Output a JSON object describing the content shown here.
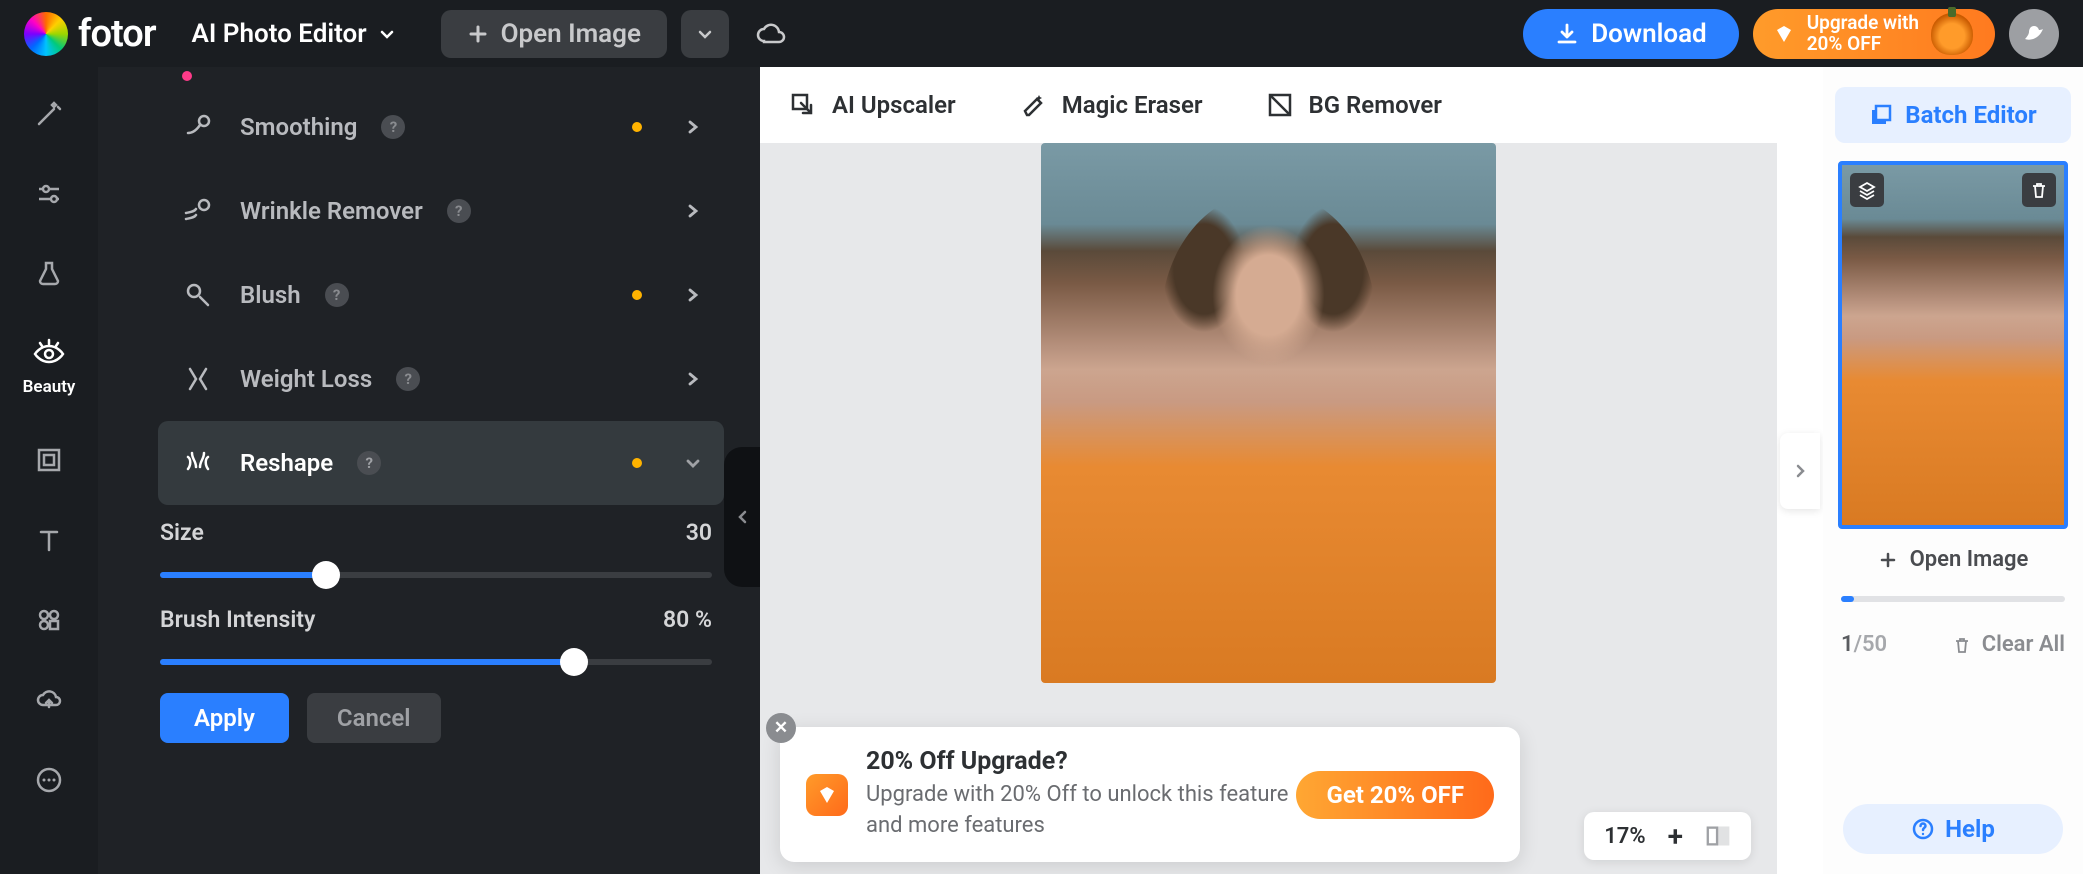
{
  "header": {
    "brand": "fotor",
    "mode": "AI Photo Editor",
    "open_image": "Open Image",
    "download": "Download",
    "upgrade_line1": "Upgrade with",
    "upgrade_line2": "20% OFF"
  },
  "rail": {
    "items": [
      "",
      "",
      "",
      "Beauty",
      "",
      "",
      "",
      "",
      ""
    ]
  },
  "panel": {
    "tools": [
      {
        "name": "Smoothing",
        "dot": true,
        "open": false
      },
      {
        "name": "Wrinkle Remover",
        "dot": false,
        "open": false
      },
      {
        "name": "Blush",
        "dot": true,
        "open": false
      },
      {
        "name": "Weight Loss",
        "dot": false,
        "open": false
      },
      {
        "name": "Reshape",
        "dot": true,
        "open": true
      }
    ],
    "sliders": {
      "size_label": "Size",
      "size_value": "30",
      "size_pct": 30,
      "brush_label": "Brush Intensity",
      "brush_value": "80 %",
      "brush_pct": 80
    },
    "apply": "Apply",
    "cancel": "Cancel"
  },
  "canvas_tools": {
    "upscaler": "AI Upscaler",
    "eraser": "Magic Eraser",
    "bg": "BG Remover"
  },
  "promo": {
    "title": "20% Off Upgrade?",
    "body": "Upgrade with 20% Off to unlock this feature and more features",
    "cta": "Get 20% OFF"
  },
  "zoom": {
    "value": "17%",
    "plus": "+"
  },
  "rpanel": {
    "batch": "Batch Editor",
    "open": "Open Image",
    "count_current": "1",
    "count_total": "/50",
    "clear": "Clear All",
    "help": "Help"
  }
}
